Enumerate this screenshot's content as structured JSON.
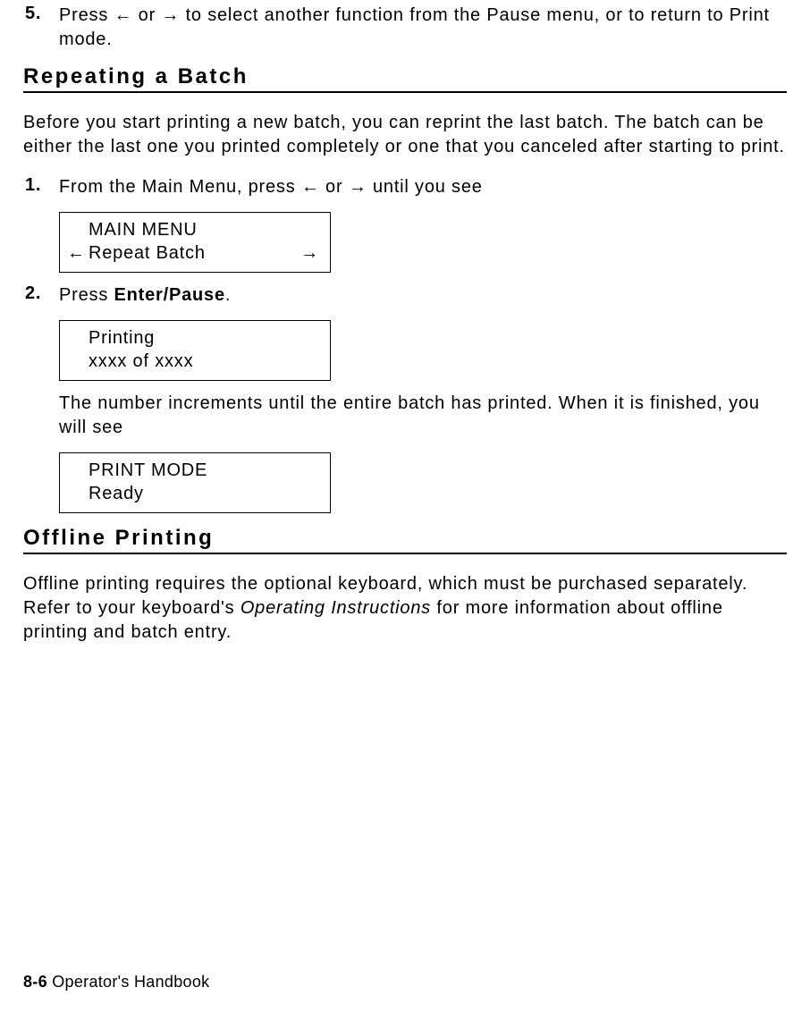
{
  "step5": {
    "number": "5.",
    "text_before": "Press ",
    "arrow_left": "←",
    "or": " or ",
    "arrow_right": "→",
    "text_after": " to select another function from the Pause menu, or to return to Print mode."
  },
  "section1": {
    "heading": "Repeating a Batch",
    "intro": "Before you start printing a new batch, you can reprint the last batch.  The batch can be either the last one you printed completely or one that you canceled after starting to print.",
    "step1": {
      "number": "1.",
      "text_before": "From the Main Menu, press ",
      "arrow_left": "←",
      "or": " or ",
      "arrow_right": "→",
      "text_after": " until you see"
    },
    "display1": {
      "line1": "MAIN MENU",
      "arrow_left": "←",
      "line2": "Repeat Batch",
      "arrow_right": "→"
    },
    "step2": {
      "number": "2.",
      "text_before": "Press ",
      "bold": "Enter/Pause",
      "text_after": "."
    },
    "display2": {
      "line1": "Printing",
      "line2": "xxxx of xxxx"
    },
    "middle_para": "The number increments until the entire batch has printed.  When it is finished, you will see",
    "display3": {
      "line1": "PRINT MODE",
      "line2": "Ready"
    }
  },
  "section2": {
    "heading": "Offline Printing",
    "para_before": "Offline printing requires the optional keyboard, which must be purchased separately.  Refer to your keyboard's ",
    "italic": "Operating Instructions",
    "para_after": " for more information about offline printing and batch entry."
  },
  "footer": {
    "page": "8-6",
    "title": "  Operator's Handbook"
  }
}
